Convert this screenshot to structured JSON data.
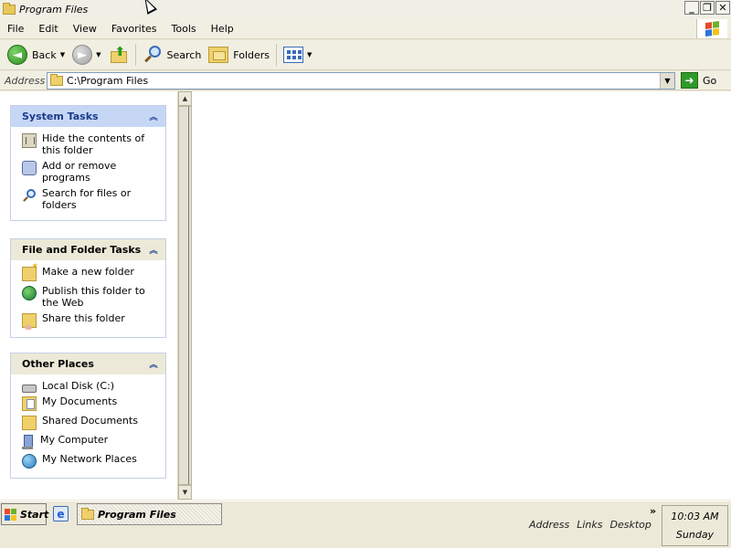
{
  "window": {
    "title": "Program Files",
    "minimize": "_",
    "restore": "❐",
    "close": "✕"
  },
  "menu": [
    "File",
    "Edit",
    "View",
    "Favorites",
    "Tools",
    "Help"
  ],
  "toolbar": {
    "back": "Back",
    "search": "Search",
    "folders": "Folders"
  },
  "address": {
    "label": "Address",
    "value": "C:\\Program Files",
    "go": "Go"
  },
  "panels": {
    "system_tasks": {
      "title": "System Tasks",
      "items": [
        "Hide the contents of this folder",
        "Add or remove programs",
        "Search for files or folders"
      ]
    },
    "file_folder_tasks": {
      "title": "File and Folder Tasks",
      "items": [
        "Make a new folder",
        "Publish this folder to the Web",
        "Share this folder"
      ]
    },
    "other_places": {
      "title": "Other Places",
      "items": [
        "Local Disk (C:)",
        "My Documents",
        "Shared Documents",
        "My Computer",
        "My Network Places"
      ]
    }
  },
  "taskbar": {
    "start": "Start",
    "task": "Program Files",
    "chevron": "»",
    "links": [
      "Address",
      "Links",
      "Desktop"
    ],
    "time": "10:03 AM",
    "day": "Sunday"
  }
}
